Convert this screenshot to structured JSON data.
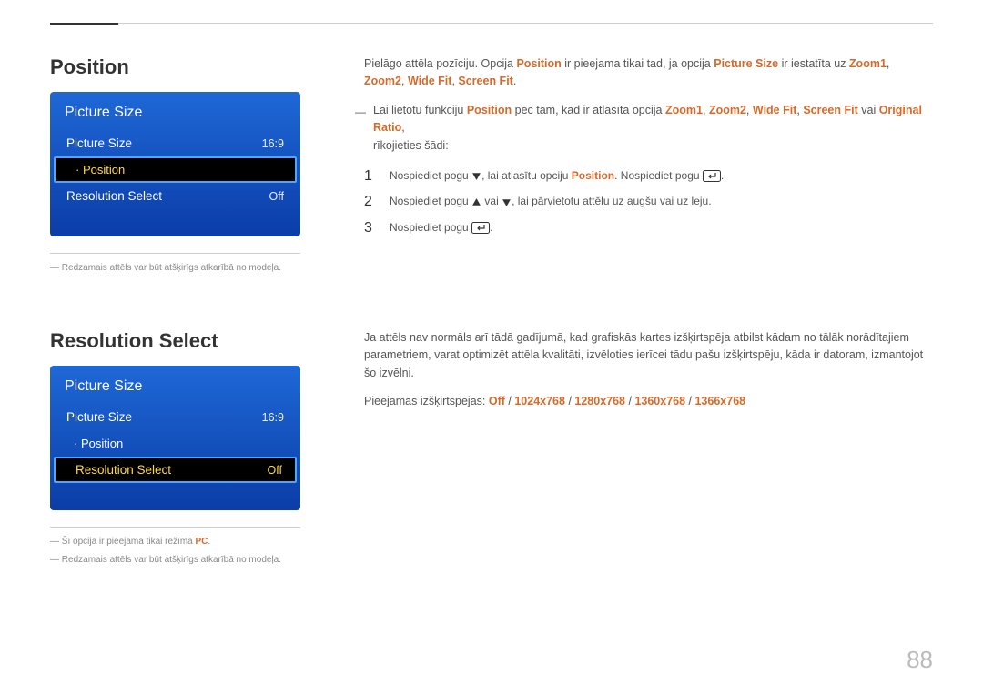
{
  "pageNumber": "88",
  "sections": [
    {
      "title": "Position",
      "osd": {
        "title": "Picture Size",
        "items": [
          {
            "label": "Picture Size",
            "value": "16:9",
            "sub": false
          },
          {
            "label": "· Position",
            "value": "",
            "sub": true,
            "selected": true
          },
          {
            "label": "Resolution Select",
            "value": "Off",
            "sub": false
          }
        ]
      },
      "footnotes": [
        {
          "segments": [
            {
              "t": "Redzamais attēls var būt atšķirīgs atkarībā no modeļa."
            }
          ]
        }
      ],
      "body": {
        "desc": {
          "segments": [
            {
              "t": "Pielāgo attēla pozīciju. Opcija "
            },
            {
              "t": "Position",
              "hl": true
            },
            {
              "t": " ir pieejama tikai tad, ja opcija "
            },
            {
              "t": "Picture Size",
              "hl": true
            },
            {
              "t": " ir iestatīta uz "
            },
            {
              "t": "Zoom1",
              "hl": true
            },
            {
              "t": ", "
            },
            {
              "t": "Zoom2",
              "hl": true
            },
            {
              "t": ", "
            },
            {
              "t": "Wide Fit",
              "hl": true
            },
            {
              "t": ", "
            },
            {
              "t": "Screen Fit",
              "hl": true
            },
            {
              "t": "."
            }
          ]
        },
        "note": {
          "lines": [
            {
              "segments": [
                {
                  "t": "Lai lietotu funkciju "
                },
                {
                  "t": "Position",
                  "hl": true
                },
                {
                  "t": " pēc tam, kad ir atlasīta opcija "
                },
                {
                  "t": "Zoom1",
                  "hl": true
                },
                {
                  "t": ", "
                },
                {
                  "t": "Zoom2",
                  "hl": true
                },
                {
                  "t": ", "
                },
                {
                  "t": "Wide Fit",
                  "hl": true
                },
                {
                  "t": ", "
                },
                {
                  "t": "Screen Fit",
                  "hl": true
                },
                {
                  "t": " vai "
                },
                {
                  "t": "Original Ratio",
                  "hl": true
                },
                {
                  "t": ","
                }
              ]
            },
            {
              "segments": [
                {
                  "t": "rīkojieties šādi:"
                }
              ]
            }
          ]
        },
        "steps": [
          {
            "segments": [
              {
                "t": "Nospiediet pogu "
              },
              {
                "icon": "down"
              },
              {
                "t": ", lai atlasītu opciju "
              },
              {
                "t": "Position",
                "hl": true
              },
              {
                "t": ". Nospiediet pogu "
              },
              {
                "icon": "enter"
              },
              {
                "t": "."
              }
            ]
          },
          {
            "segments": [
              {
                "t": "Nospiediet pogu "
              },
              {
                "icon": "up"
              },
              {
                "t": " vai "
              },
              {
                "icon": "down"
              },
              {
                "t": ", lai pārvietotu attēlu uz augšu vai uz leju."
              }
            ]
          },
          {
            "segments": [
              {
                "t": "Nospiediet pogu "
              },
              {
                "icon": "enter"
              },
              {
                "t": "."
              }
            ]
          }
        ]
      }
    },
    {
      "title": "Resolution Select",
      "osd": {
        "title": "Picture Size",
        "items": [
          {
            "label": "Picture Size",
            "value": "16:9",
            "sub": false
          },
          {
            "label": "· Position",
            "value": "",
            "sub": true
          },
          {
            "label": "Resolution Select",
            "value": "Off",
            "sub": false,
            "selected": true
          }
        ]
      },
      "footnotes": [
        {
          "segments": [
            {
              "t": "Šī opcija ir pieejama tikai režīmā "
            },
            {
              "t": "PC",
              "hl": true
            },
            {
              "t": "."
            }
          ]
        },
        {
          "segments": [
            {
              "t": "Redzamais attēls var būt atšķirīgs atkarībā no modeļa."
            }
          ]
        }
      ],
      "body": {
        "desc": {
          "segments": [
            {
              "t": "Ja attēls nav normāls arī tādā gadījumā, kad grafiskās kartes izšķirtspēja atbilst kādam no tālāk norādītajiem parametriem, varat optimizēt attēla kvalitāti, izvēloties ierīcei tādu pašu izšķirtspēju, kāda ir datoram, izmantojot šo izvēlni."
            }
          ]
        },
        "resline": {
          "segments": [
            {
              "t": "Pieejamās izšķirtspējas: "
            },
            {
              "t": "Off",
              "hl": true
            },
            {
              "t": " / "
            },
            {
              "t": "1024x768",
              "hl": true
            },
            {
              "t": " / "
            },
            {
              "t": "1280x768",
              "hl": true
            },
            {
              "t": " / "
            },
            {
              "t": "1360x768",
              "hl": true
            },
            {
              "t": " / "
            },
            {
              "t": "1366x768",
              "hl": true
            }
          ]
        }
      }
    }
  ]
}
